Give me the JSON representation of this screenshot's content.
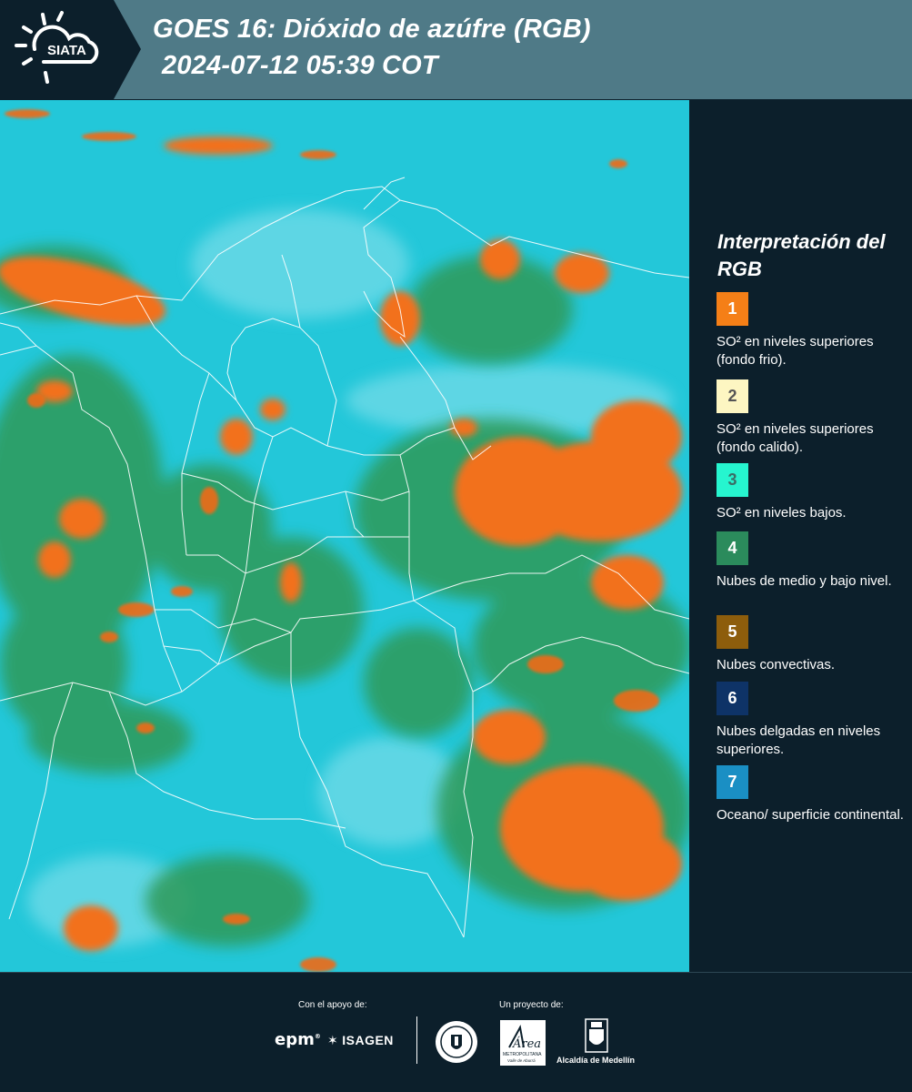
{
  "header": {
    "logo_text": "SIATA",
    "title_line1": "GOES 16: Dióxido de azúfre (RGB)",
    "title_line2": "2024-07-12 05:39 COT"
  },
  "legend": {
    "title": "Interpretación del RGB",
    "items": [
      {
        "number": "1",
        "label": "SO² en niveles superiores (fondo frio).",
        "color": "#f57f17",
        "text_color": "#ffffff"
      },
      {
        "number": "2",
        "label": "SO² en niveles superiores (fondo calido).",
        "color": "#fdf6c2",
        "text_color": "#555555"
      },
      {
        "number": "3",
        "label": "SO² en niveles bajos.",
        "color": "#26f5cf",
        "text_color": "#3a6e66"
      },
      {
        "number": "4",
        "label": "Nubes de medio y bajo nivel.",
        "color": "#2b8b5c",
        "text_color": "#ffffff"
      },
      {
        "number": "5",
        "label": "Nubes convectivas.",
        "color": "#8d5d0c",
        "text_color": "#ffffff"
      },
      {
        "number": "6",
        "label": "Nubes delgadas en niveles superiores.",
        "color": "#0e3367",
        "text_color": "#ffffff"
      },
      {
        "number": "7",
        "label": "Oceano/ superficie continental.",
        "color": "#1a8fc4",
        "text_color": "#ffffff"
      }
    ]
  },
  "footer": {
    "support_label": "Con el apoyo de:",
    "project_label": "Un proyecto de:",
    "epm_logo": "epm",
    "isagen_logo": "ISAGEN",
    "area_logo": "Área",
    "area_sub1": "METROPOLITANA",
    "area_sub2": "Valle de Aburrá",
    "alcaldia_label": "Alcaldía de Medellín"
  },
  "colors": {
    "header_bg": "#4f7a87",
    "panel_bg": "#0c1f2b",
    "map_base": "#23c7d9",
    "convective": "#f2711d",
    "low_cloud": "#2f9a58"
  }
}
